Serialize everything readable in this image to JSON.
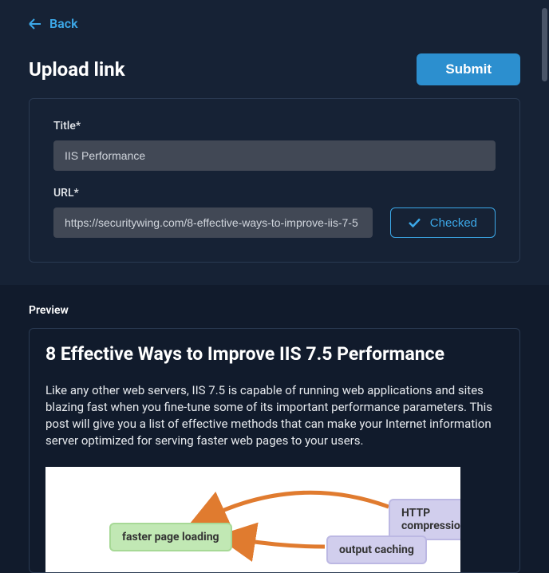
{
  "nav": {
    "back_label": "Back"
  },
  "header": {
    "title": "Upload link",
    "submit_label": "Submit"
  },
  "form": {
    "title_label": "Title*",
    "title_value": "IIS Performance",
    "url_label": "URL*",
    "url_value": "https://securitywing.com/8-effective-ways-to-improve-iis-7-5",
    "checked_label": "Checked"
  },
  "preview": {
    "section_label": "Preview",
    "article_title": "8 Effective Ways to Improve IIS 7.5 Performance",
    "article_desc": "Like any other web servers, IIS 7.5 is capable of running web applications and sites blazing fast when you fine-tune some of its important performance parameters. This post will give you a list of effective methods that can make your Internet information server optimized for serving faster web pages to your users.",
    "diagram": {
      "node1": "faster page loading",
      "node2": "HTTP compression",
      "node3": "output caching"
    }
  }
}
